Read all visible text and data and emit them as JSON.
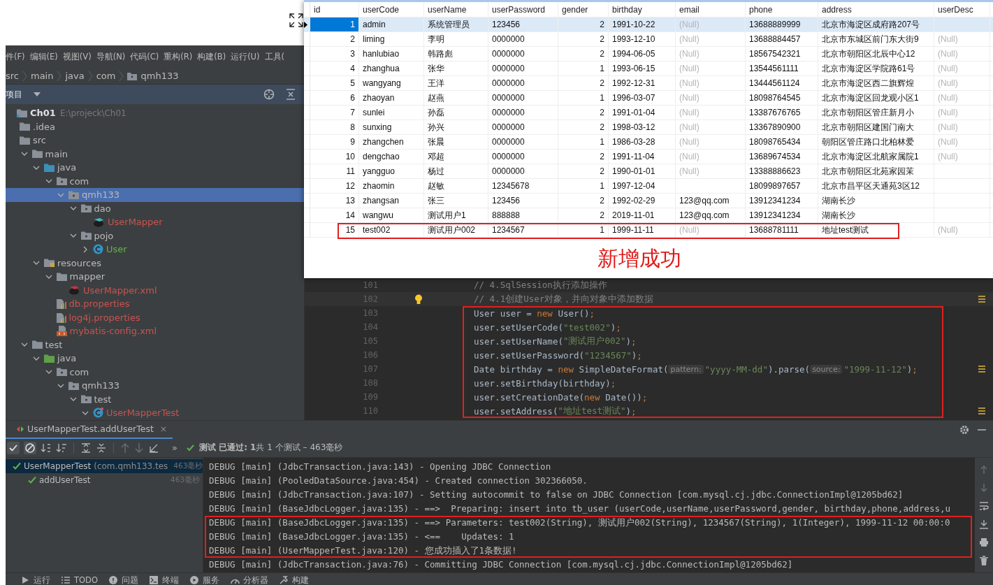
{
  "menu": [
    "件(F)",
    "编辑(E)",
    "视图(V)",
    "导航(N)",
    "代码(C)",
    "重构(R)",
    "构建(B)",
    "运行(U)",
    "工具("
  ],
  "breadcrumb": [
    {
      "label": "src",
      "kind": "text"
    },
    {
      "label": "main",
      "kind": "text"
    },
    {
      "label": "java",
      "kind": "text"
    },
    {
      "label": "com",
      "kind": "text"
    },
    {
      "label": "qmh133",
      "kind": "package"
    }
  ],
  "project": {
    "title": "项目",
    "tree": [
      {
        "kind": "module",
        "label": "Ch01",
        "path": "E:\\projeck\\Ch01",
        "selected": false,
        "children": [
          {
            "kind": "folder",
            "label": ".idea",
            "selected": false
          },
          {
            "kind": "folder",
            "label": "src",
            "selected": false,
            "children": [
              {
                "kind": "folder",
                "label": "main",
                "expanded": true,
                "selected": false,
                "children": [
                  {
                    "kind": "source-root",
                    "label": "java",
                    "expanded": true,
                    "selected": false,
                    "children": [
                      {
                        "kind": "package",
                        "label": "com",
                        "expanded": true,
                        "selected": false,
                        "children": [
                          {
                            "kind": "package",
                            "label": "qmh133",
                            "expanded": true,
                            "selected": true,
                            "children": [
                              {
                                "kind": "package",
                                "label": "dao",
                                "expanded": true,
                                "selected": false,
                                "children": [
                                  {
                                    "kind": "mapper",
                                    "label": "UserMapper",
                                    "color": "#c75450",
                                    "selected": false
                                  }
                                ]
                              },
                              {
                                "kind": "package",
                                "label": "pojo",
                                "expanded": true,
                                "selected": false,
                                "children": [
                                  {
                                    "kind": "class",
                                    "label": "User",
                                    "color": "#62b543",
                                    "expanded": false,
                                    "selected": false
                                  }
                                ]
                              }
                            ]
                          }
                        ]
                      }
                    ]
                  },
                  {
                    "kind": "resources-root",
                    "label": "resources",
                    "expanded": true,
                    "selected": false,
                    "children": [
                      {
                        "kind": "folder",
                        "label": "mapper",
                        "expanded": true,
                        "selected": false,
                        "children": [
                          {
                            "kind": "mapper-xml",
                            "label": "UserMapper.xml",
                            "color": "#c75450",
                            "selected": false
                          }
                        ]
                      },
                      {
                        "kind": "properties",
                        "label": "db.properties",
                        "color": "#c75450",
                        "selected": false
                      },
                      {
                        "kind": "properties",
                        "label": "log4j.properties",
                        "color": "#c75450",
                        "selected": false
                      },
                      {
                        "kind": "config-xml",
                        "label": "mybatis-config.xml",
                        "color": "#c75450",
                        "selected": false
                      }
                    ]
                  }
                ]
              },
              {
                "kind": "folder",
                "label": "test",
                "expanded": true,
                "selected": false,
                "children": [
                  {
                    "kind": "test-root",
                    "label": "java",
                    "expanded": true,
                    "selected": false,
                    "children": [
                      {
                        "kind": "package",
                        "label": "com",
                        "expanded": true,
                        "selected": false,
                        "children": [
                          {
                            "kind": "package",
                            "label": "qmh133",
                            "expanded": true,
                            "selected": false,
                            "children": [
                              {
                                "kind": "package",
                                "label": "test",
                                "expanded": true,
                                "selected": false,
                                "children": [
                                  {
                                    "kind": "test-class",
                                    "label": "UserMapperTest",
                                    "color": "#c75450",
                                    "expanded": true,
                                    "selected": false
                                  }
                                ]
                              }
                            ]
                          }
                        ]
                      }
                    ]
                  }
                ]
              }
            ]
          }
        ]
      }
    ]
  },
  "editor": {
    "lines": [
      {
        "no": "101",
        "current": false,
        "highlighted": false,
        "marker": false,
        "tokens": [
          {
            "kind": "comment",
            "text": "// 4.SqlSession执行添加操作"
          }
        ]
      },
      {
        "no": "102",
        "current": true,
        "highlighted": false,
        "marker": true,
        "tokens": [
          {
            "kind": "comment",
            "text": "// 4.1创建User对象，并向对象中添加数据"
          }
        ]
      },
      {
        "no": "103",
        "current": false,
        "highlighted": true,
        "marker": false,
        "tokens": [
          {
            "kind": "plain",
            "text": "User user = "
          },
          {
            "kind": "keyword",
            "text": "new"
          },
          {
            "kind": "plain",
            "text": " User()"
          },
          {
            "kind": "keyword",
            "text": ";"
          }
        ]
      },
      {
        "no": "104",
        "current": false,
        "highlighted": true,
        "marker": false,
        "tokens": [
          {
            "kind": "plain",
            "text": "user.setUserCode("
          },
          {
            "kind": "string",
            "text": "\"test002\""
          },
          {
            "kind": "plain",
            "text": ")"
          },
          {
            "kind": "keyword",
            "text": ";"
          }
        ]
      },
      {
        "no": "105",
        "current": false,
        "highlighted": true,
        "marker": false,
        "tokens": [
          {
            "kind": "plain",
            "text": "user.setUserName("
          },
          {
            "kind": "string",
            "text": "\"测试用户002\""
          },
          {
            "kind": "plain",
            "text": ")"
          },
          {
            "kind": "keyword",
            "text": ";"
          }
        ]
      },
      {
        "no": "106",
        "current": false,
        "highlighted": true,
        "marker": false,
        "tokens": [
          {
            "kind": "plain",
            "text": "user.setUserPassword("
          },
          {
            "kind": "string",
            "text": "\"1234567\""
          },
          {
            "kind": "plain",
            "text": ")"
          },
          {
            "kind": "keyword",
            "text": ";"
          }
        ]
      },
      {
        "no": "107",
        "current": false,
        "highlighted": true,
        "marker": true,
        "tokens": [
          {
            "kind": "plain",
            "text": "Date birthday = "
          },
          {
            "kind": "keyword",
            "text": "new"
          },
          {
            "kind": "plain",
            "text": " SimpleDateFormat("
          },
          {
            "kind": "hint",
            "text": "pattern:"
          },
          {
            "kind": "string",
            "text": "\"yyyy-MM-dd\""
          },
          {
            "kind": "plain",
            "text": ").parse("
          },
          {
            "kind": "hint",
            "text": "source:"
          },
          {
            "kind": "string",
            "text": "\"1999-11-12\""
          },
          {
            "kind": "plain",
            "text": ")"
          },
          {
            "kind": "keyword",
            "text": ";"
          }
        ]
      },
      {
        "no": "108",
        "current": false,
        "highlighted": true,
        "marker": false,
        "tokens": [
          {
            "kind": "plain",
            "text": "user.setBirthday(birthday)"
          },
          {
            "kind": "keyword",
            "text": ";"
          }
        ]
      },
      {
        "no": "109",
        "current": false,
        "highlighted": true,
        "marker": false,
        "tokens": [
          {
            "kind": "plain",
            "text": "user.setCreationDate("
          },
          {
            "kind": "keyword",
            "text": "new"
          },
          {
            "kind": "plain",
            "text": " Date())"
          },
          {
            "kind": "keyword",
            "text": ";"
          }
        ]
      },
      {
        "no": "110",
        "current": false,
        "highlighted": true,
        "marker": true,
        "tokens": [
          {
            "kind": "plain",
            "text": "user.setAddress("
          },
          {
            "kind": "string",
            "text": "\"地址test测试\""
          },
          {
            "kind": "plain",
            "text": ")"
          },
          {
            "kind": "keyword",
            "text": ";"
          }
        ]
      }
    ]
  },
  "run_panel": {
    "tab": "UserMapperTest.addUserTest",
    "close": "×",
    "more": "»",
    "status": "**测试 已通过: 1**共 1 个测试 – 463毫秒",
    "tests": [
      {
        "name": "UserMapperTest",
        "package": "(com.qmh133.tes",
        "time": "463毫秒",
        "passed": true,
        "children": [
          {
            "name": "addUserTest",
            "time": "463毫秒",
            "passed": true
          }
        ]
      }
    ],
    "console": [
      {
        "text": "DEBUG [main] (JdbcTransaction.java:143) - Opening JDBC Connection",
        "highlighted": false
      },
      {
        "text": "DEBUG [main] (PooledDataSource.java:454) - Created connection 302366050.",
        "highlighted": false
      },
      {
        "text": "DEBUG [main] (JdbcTransaction.java:107) - Setting autocommit to false on JDBC Connection [com.mysql.cj.jdbc.ConnectionImpl@1205bd62]",
        "highlighted": false
      },
      {
        "text": "DEBUG [main] (BaseJdbcLogger.java:135) - ==>  Preparing: insert into tb_user (userCode,userName,userPassword,gender, birthday,phone,address,u",
        "highlighted": false
      },
      {
        "text": "DEBUG [main] (BaseJdbcLogger.java:135) - ==> Parameters: test002(String), 测试用户002(String), 1234567(String), 1(Integer), 1999-11-12 00:00:0",
        "highlighted": true
      },
      {
        "text": "DEBUG [main] (BaseJdbcLogger.java:135) - <==    Updates: 1",
        "highlighted": true
      },
      {
        "text": "DEBUG [main] (UserMapperTest.java:120) - 您成功插入了1条数据!",
        "highlighted": true
      },
      {
        "text": "DEBUG [main] (JdbcTransaction.java:76) - Committing JDBC Connection [com.mysql.cj.jdbc.ConnectionImpl@1205bd62]",
        "highlighted": false
      }
    ]
  },
  "status_bar": [
    {
      "kind": "run",
      "label": "运行"
    },
    {
      "kind": "todo",
      "label": "TODO"
    },
    {
      "kind": "problems",
      "label": "问题"
    },
    {
      "kind": "terminal",
      "label": "终端"
    },
    {
      "kind": "services",
      "label": "服务"
    },
    {
      "kind": "profiler",
      "label": "分析器"
    },
    {
      "kind": "build",
      "label": "构建"
    }
  ],
  "table": {
    "columns": [
      {
        "label": "id",
        "kind": "number"
      },
      {
        "label": "userCode",
        "kind": "text"
      },
      {
        "label": "userName",
        "kind": "text"
      },
      {
        "label": "userPassword",
        "kind": "text"
      },
      {
        "label": "gender",
        "kind": "number"
      },
      {
        "label": "birthday",
        "kind": "text"
      },
      {
        "label": "email",
        "kind": "text"
      },
      {
        "label": "phone",
        "kind": "text"
      },
      {
        "label": "address",
        "kind": "text"
      },
      {
        "label": "userDesc",
        "kind": "text"
      }
    ],
    "rows": [
      {
        "selected": true,
        "highlighted": false,
        "cells": [
          "1",
          "admin",
          "系统管理员",
          "123456",
          "2",
          "1991-10-22",
          {
            "text": "(Null)",
            "null": true
          },
          "13688889999",
          "北京市海淀区成府路207号",
          ""
        ]
      },
      {
        "selected": false,
        "highlighted": false,
        "cells": [
          "2",
          "liming",
          "李明",
          "0000000",
          "2",
          "1993-12-10",
          {
            "text": "(Null)",
            "null": true
          },
          "13688884457",
          "北京市东城区前门东大街9",
          {
            "text": "(Null)",
            "null": true
          }
        ]
      },
      {
        "selected": false,
        "highlighted": false,
        "cells": [
          "3",
          "hanlubiao",
          "韩路彪",
          "0000000",
          "2",
          "1994-06-05",
          {
            "text": "(Null)",
            "null": true
          },
          "18567542321",
          "北京市朝阳区北辰中心12",
          {
            "text": "(Null)",
            "null": true
          }
        ]
      },
      {
        "selected": false,
        "highlighted": false,
        "cells": [
          "4",
          "zhanghua",
          "张华",
          "0000000",
          "1",
          "1993-06-15",
          {
            "text": "(Null)",
            "null": true
          },
          "13544561111",
          "北京市海淀区学院路61号",
          {
            "text": "(Null)",
            "null": true
          }
        ]
      },
      {
        "selected": false,
        "highlighted": false,
        "cells": [
          "5",
          "wangyang",
          "王洋",
          "0000000",
          "2",
          "1992-12-31",
          {
            "text": "(Null)",
            "null": true
          },
          "13444561124",
          "北京市海淀区西二旗辉煌",
          {
            "text": "(Null)",
            "null": true
          }
        ]
      },
      {
        "selected": false,
        "highlighted": false,
        "cells": [
          "6",
          "zhaoyan",
          "赵燕",
          "0000000",
          "1",
          "1996-03-07",
          {
            "text": "(Null)",
            "null": true
          },
          "18098764545",
          "北京市海淀区回龙观小区1",
          {
            "text": "(Null)",
            "null": true
          }
        ]
      },
      {
        "selected": false,
        "highlighted": false,
        "cells": [
          "7",
          "sunlei",
          "孙磊",
          "0000000",
          "2",
          "1991-01-04",
          {
            "text": "(Null)",
            "null": true
          },
          "13387676765",
          "北京市朝阳区管庄新月小",
          {
            "text": "(Null)",
            "null": true
          }
        ]
      },
      {
        "selected": false,
        "highlighted": false,
        "cells": [
          "8",
          "sunxing",
          "孙兴",
          "0000000",
          "2",
          "1998-03-12",
          {
            "text": "(Null)",
            "null": true
          },
          "13367890900",
          "北京市朝阳区建国门南大",
          {
            "text": "(Null)",
            "null": true
          }
        ]
      },
      {
        "selected": false,
        "highlighted": false,
        "cells": [
          "9",
          "zhangchen",
          "张晨",
          "0000000",
          "1",
          "1986-03-28",
          {
            "text": "(Null)",
            "null": true
          },
          "18098765434",
          "朝阳区管庄路口北柏林爱",
          {
            "text": "(Null)",
            "null": true
          }
        ]
      },
      {
        "selected": false,
        "highlighted": false,
        "cells": [
          "10",
          "dengchao",
          "邓超",
          "0000000",
          "2",
          "1991-11-04",
          {
            "text": "(Null)",
            "null": true
          },
          "13689674534",
          "北京市海淀区北航家属院1",
          {
            "text": "(Null)",
            "null": true
          }
        ]
      },
      {
        "selected": false,
        "highlighted": false,
        "cells": [
          "11",
          "yangguo",
          "杨过",
          "0000000",
          "2",
          "1990-01-01",
          {
            "text": "(Null)",
            "null": true
          },
          "13388886623",
          "北京市朝阳区北苑家园茉",
          ""
        ]
      },
      {
        "selected": false,
        "highlighted": false,
        "cells": [
          "12",
          "zhaomin",
          "赵敏",
          "12345678",
          "1",
          "1997-12-04",
          "",
          "18099897657",
          "北京市昌平区天通苑3区12",
          ""
        ]
      },
      {
        "selected": false,
        "highlighted": false,
        "cells": [
          "13",
          "zhangsan",
          "张三",
          "123456",
          "2",
          "1992-02-29",
          "123@qq.com",
          "13912341234",
          "湖南长沙",
          ""
        ]
      },
      {
        "selected": false,
        "highlighted": false,
        "cells": [
          "14",
          "wangwu",
          "测试用户1",
          "888888",
          "2",
          "2019-11-01",
          "123@qq.com",
          "13912341234",
          "湖南长沙",
          ""
        ]
      },
      {
        "selected": false,
        "highlighted": true,
        "cells": [
          "15",
          "test002",
          "测试用户002",
          "1234567",
          "1",
          "1999-11-11",
          {
            "text": "(Null)",
            "null": true
          },
          "13688781111",
          "地址test测试",
          {
            "text": "(Null)",
            "null": true
          }
        ]
      }
    ]
  },
  "annotation": "新增成功"
}
